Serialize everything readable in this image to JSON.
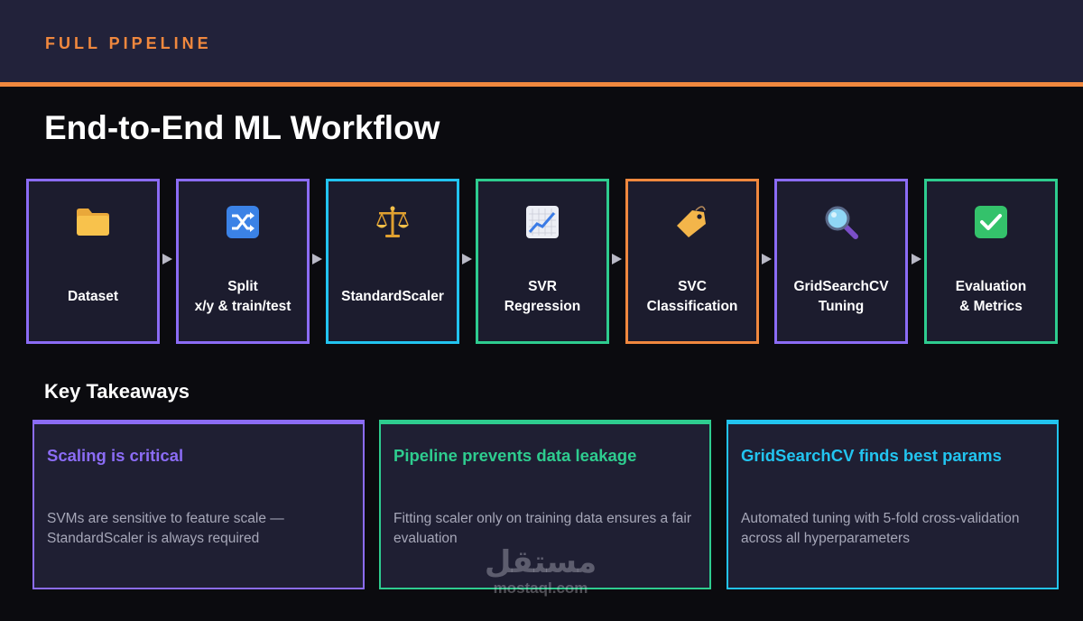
{
  "header": {
    "label": "FULL PIPELINE",
    "accent_color": "#f0883e"
  },
  "title": "End-to-End ML Workflow",
  "pipeline": {
    "steps": [
      {
        "line1": "Dataset",
        "line2": "",
        "icon": "folder-icon",
        "color": "#8b6cf5"
      },
      {
        "line1": "Split",
        "line2": "x/y & train/test",
        "icon": "shuffle-icon",
        "color": "#8b6cf5"
      },
      {
        "line1": "StandardScaler",
        "line2": "",
        "icon": "scale-icon",
        "color": "#22c4f0"
      },
      {
        "line1": "SVR",
        "line2": "Regression",
        "icon": "chart-increasing-icon",
        "color": "#2ecc8f"
      },
      {
        "line1": "SVC",
        "line2": "Classification",
        "icon": "tag-icon",
        "color": "#f0883e"
      },
      {
        "line1": "GridSearchCV",
        "line2": "Tuning",
        "icon": "magnifier-icon",
        "color": "#8b6cf5"
      },
      {
        "line1": "Evaluation",
        "line2": "& Metrics",
        "icon": "check-box-icon",
        "color": "#2ecc8f"
      }
    ]
  },
  "takeaways": {
    "heading": "Key Takeaways",
    "cards": [
      {
        "title": "Scaling is critical",
        "body": "SVMs are sensitive to feature scale — StandardScaler is always required",
        "color": "#8b6cf5"
      },
      {
        "title": "Pipeline prevents data leakage",
        "body": "Fitting scaler only on training data ensures a fair evaluation",
        "color": "#2ecc8f"
      },
      {
        "title": "GridSearchCV finds best params",
        "body": "Automated tuning with 5-fold cross-validation across all hyperparameters",
        "color": "#22c4f0"
      }
    ]
  },
  "watermark": {
    "arabic": "مستقل",
    "latin": "mostaql.com"
  }
}
